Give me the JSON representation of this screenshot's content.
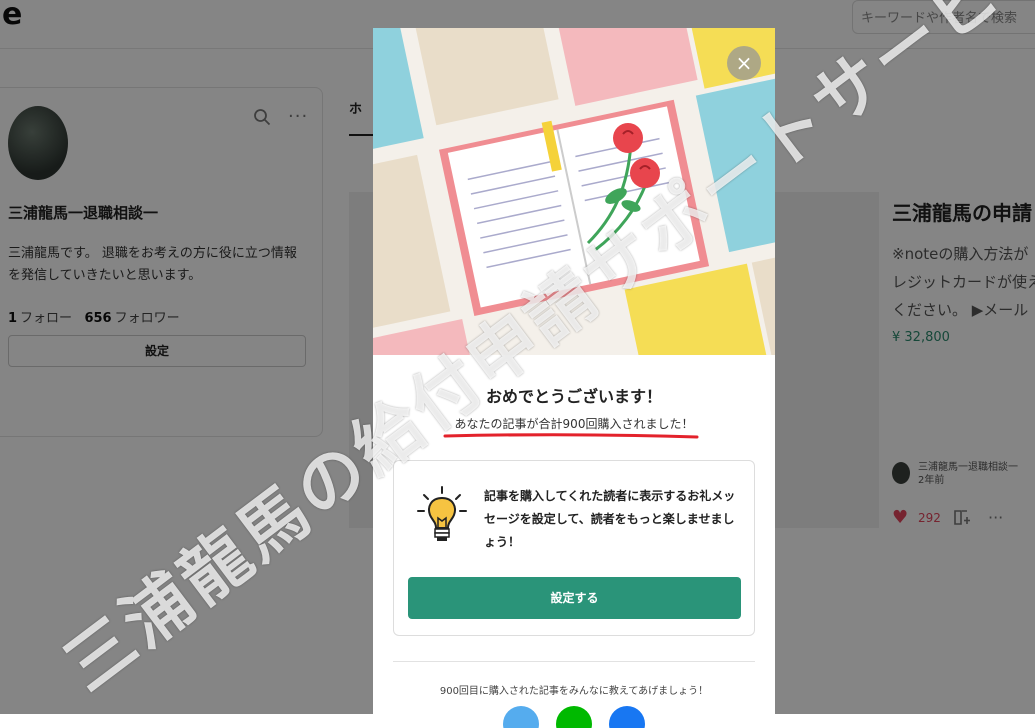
{
  "header": {
    "logo": "e",
    "search_placeholder": "キーワードや作者名で検索"
  },
  "profile": {
    "name": "三浦龍馬一退職相談一",
    "description": "三浦龍馬です。 退職をお考えの方に役に立つ情報を発信していきたいと思います。",
    "follow_count": "1",
    "follow_label": "フォロー",
    "follower_count": "656",
    "follower_label": "フォロワー",
    "settings_label": "設定",
    "more_label": "···"
  },
  "tabs": {
    "active_label": "ホ"
  },
  "article": {
    "title": "三浦龍馬の申請",
    "body_lines": [
      "※noteの購入方法が",
      "レジットカードが使え",
      "ください。 ▶メール"
    ],
    "price": "¥ 32,800",
    "author": "三浦龍馬一退職相談一",
    "posted": "2年前",
    "likes": "292",
    "more_label": "···"
  },
  "modal": {
    "close_label": "×",
    "title": "おめでとうございます！",
    "subtitle": "あなたの記事が合計900回購入されました！",
    "message": "記事を購入してくれた読者に表示するお礼メッセージを設定して、読者をもっと楽しませましょう！",
    "primary_button": "設定する",
    "share_prompt": "900回目に購入された記事をみんなに教えてあげましょう！",
    "share_colors": [
      "#55acee",
      "#00b900",
      "#1877f2"
    ]
  },
  "watermark": "三浦龍馬の給付申請サポートサービス",
  "colors": {
    "accent": "#2a9479",
    "underline": "#e3222b",
    "like": "#e2455d"
  }
}
